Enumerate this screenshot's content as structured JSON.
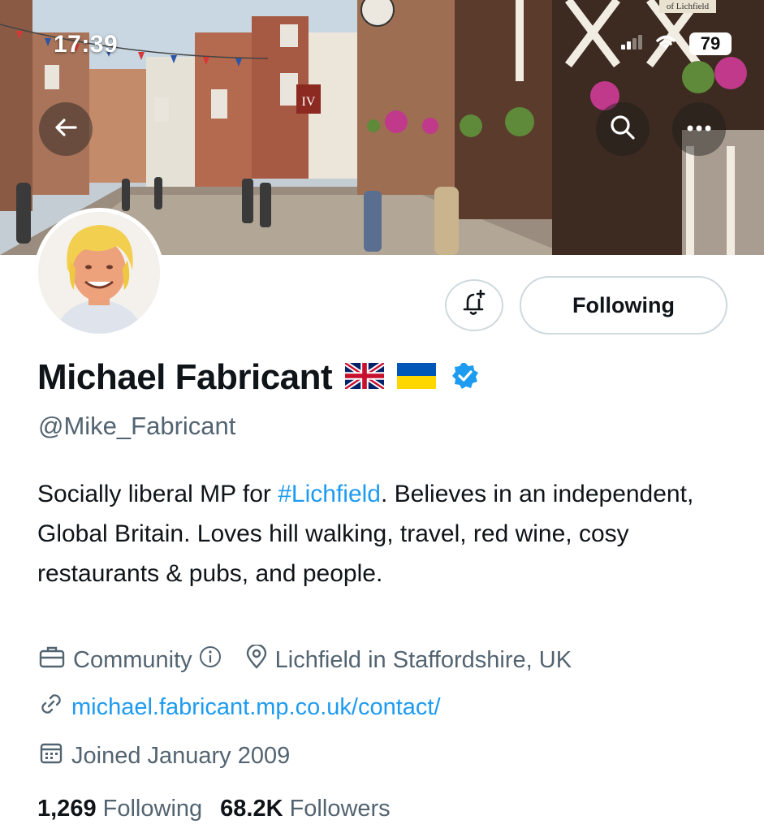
{
  "status_bar": {
    "time": "17:39",
    "battery": "79",
    "icons": [
      "signal-icon",
      "wifi-icon",
      "battery-icon"
    ]
  },
  "header": {
    "icons": [
      "back-arrow-icon",
      "search-icon",
      "more-icon"
    ]
  },
  "banner": {
    "sign_text": "of Lichfield",
    "shop_sign": "IV"
  },
  "profile": {
    "display_name": "Michael Fabricant",
    "flags": [
      "uk-flag-icon",
      "ukraine-flag-icon"
    ],
    "verified_icon": "verified-badge-icon",
    "handle": "@Mike_Fabricant",
    "bio": {
      "before": "Socially liberal MP for ",
      "hashtag": "#Lichfield",
      "after": ". Believes in an independent, Global Britain. Loves hill walking, travel, red wine, cosy restaurants & pubs, and people."
    },
    "category": "Community",
    "location": "Lichfield in Staffordshire, UK",
    "website": "michael.fabricant.mp.co.uk/contact/",
    "joined": "Joined January 2009",
    "following_count": "1,269",
    "following_label": "Following",
    "followers_count": "68.2K",
    "followers_label": "Followers"
  },
  "actions": {
    "notify_icon": "bell-plus-icon",
    "following_button": "Following"
  },
  "colors": {
    "accent": "#1d9bf0",
    "text": "#0f1419",
    "secondary_text": "#536471",
    "border": "#cfd9de"
  }
}
